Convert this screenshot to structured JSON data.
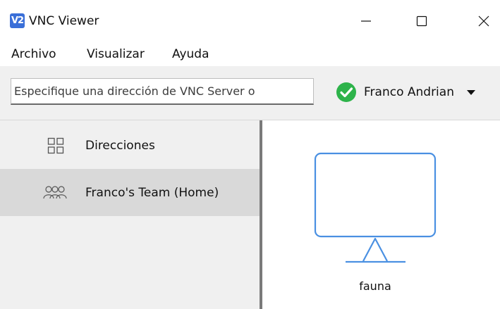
{
  "window": {
    "logo_text": "V2",
    "title": "VNC Viewer"
  },
  "menu": {
    "items": [
      "Archivo",
      "Visualizar",
      "Ayuda"
    ]
  },
  "toolbar": {
    "address_placeholder": "Especifique una dirección de VNC Server o",
    "address_value": "",
    "user_name": "Franco Andrian",
    "signed_in_color": "#2db34a"
  },
  "sidebar": {
    "items": [
      {
        "label": "Direcciones",
        "icon": "grid-icon",
        "selected": false
      },
      {
        "label": "Franco's Team (Home)",
        "icon": "team-icon",
        "selected": true
      }
    ]
  },
  "main": {
    "computers": [
      {
        "label": "fauna",
        "icon": "computer-monitor-icon"
      }
    ]
  },
  "colors": {
    "accent": "#4a90e2",
    "sidebar_bg": "#f0f0f0",
    "selected_bg": "#d9d9d9"
  }
}
